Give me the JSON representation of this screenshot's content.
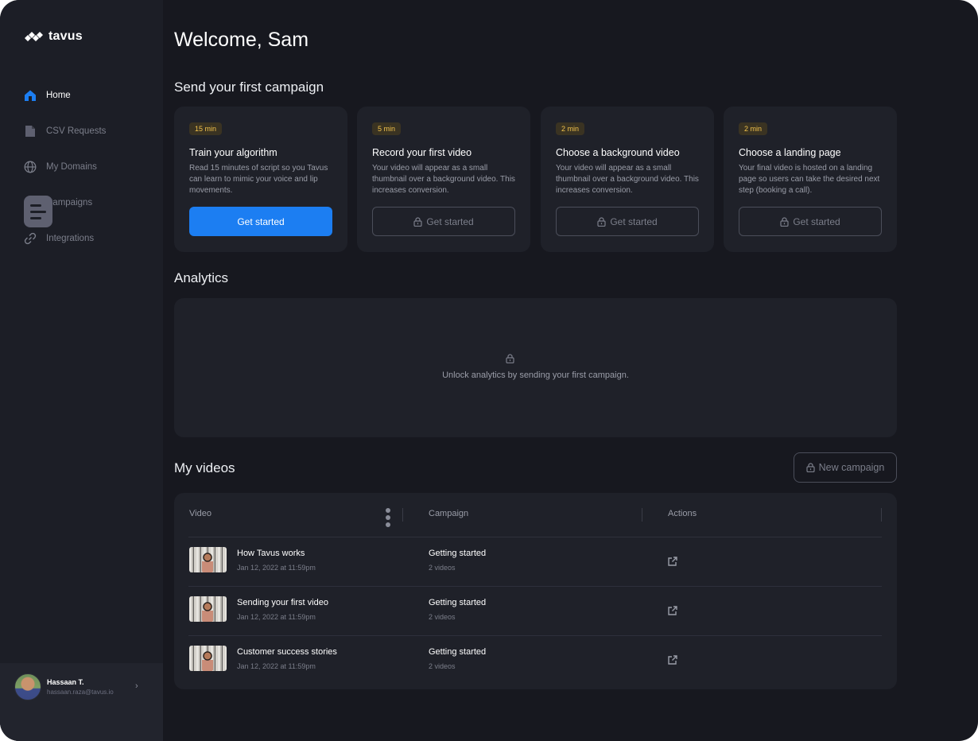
{
  "brand": {
    "name": "tavus"
  },
  "sidebar": {
    "items": [
      {
        "label": "Home",
        "icon": "home-icon",
        "active": true
      },
      {
        "label": "CSV Requests",
        "icon": "document-icon",
        "active": false
      },
      {
        "label": "My Domains",
        "icon": "globe-icon",
        "active": false
      },
      {
        "label": "Campaigns",
        "icon": "campaign-icon",
        "active": false
      },
      {
        "label": "Integrations",
        "icon": "link-icon",
        "active": false
      }
    ],
    "toggle_icon": "menu-toggle-icon"
  },
  "user": {
    "name": "Hassaan T.",
    "email": "hassaan.raza@tavus.io"
  },
  "main": {
    "welcome": "Welcome, Sam",
    "campaign_section_title": "Send your first campaign",
    "cards": [
      {
        "badge": "15 min",
        "title": "Train your algorithm",
        "description": "Read 15 minutes of script so you Tavus can learn to mimic your voice and lip movements.",
        "button": "Get started",
        "locked": false
      },
      {
        "badge": "5 min",
        "title": "Record your first video",
        "description": "Your video will appear as a small thumbnail over a background video. This increases conversion.",
        "button": "Get started",
        "locked": true
      },
      {
        "badge": "2 min",
        "title": "Choose a background video",
        "description": "Your video will appear as a small thumbnail over a background video. This increases conversion.",
        "button": "Get started",
        "locked": true
      },
      {
        "badge": "2 min",
        "title": "Choose a landing page",
        "description": "Your final video is hosted on a landing page so users can take the desired next step (booking a call).",
        "button": "Get started",
        "locked": true
      }
    ],
    "analytics": {
      "title": "Analytics",
      "message": "Unlock analytics by sending your first campaign."
    },
    "videos": {
      "title": "My videos",
      "new_campaign_label": "New campaign",
      "columns": [
        "Video",
        "Campaign",
        "Actions"
      ],
      "rows": [
        {
          "title": "How Tavus works",
          "date": "Jan 12, 2022 at 11:59pm",
          "campaign": "Getting started",
          "count": "2 videos"
        },
        {
          "title": "Sending your first video",
          "date": "Jan 12, 2022 at 11:59pm",
          "campaign": "Getting started",
          "count": "2 videos"
        },
        {
          "title": "Customer success stories",
          "date": "Jan 12, 2022 at 11:59pm",
          "campaign": "Getting started",
          "count": "2 videos"
        }
      ]
    }
  },
  "colors": {
    "accent": "#1c7ef2",
    "background": "#17181f",
    "sidebar": "#1c1e26",
    "card": "#1f2129",
    "badge_text": "#f1c24c"
  }
}
